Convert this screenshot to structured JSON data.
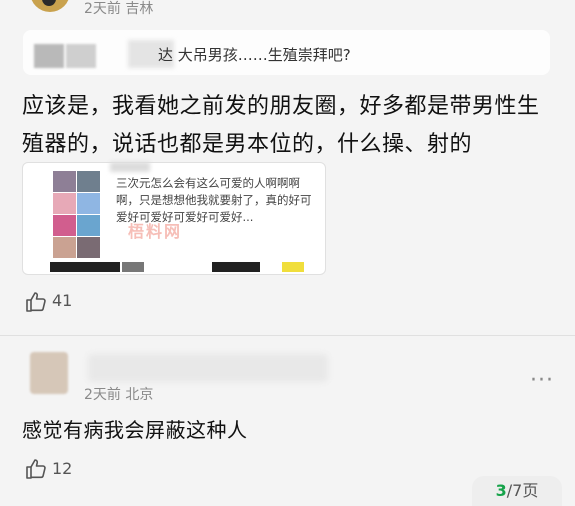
{
  "top_comment": {
    "meta": "2天前 吉林",
    "quote": "达 大吊男孩……生殖崇拜吧?",
    "text": "应该是，我看她之前发的朋友圈，好多都是带男性生殖器的，说话也都是男本位的，什么操、射的",
    "embed": {
      "text": "三次元怎么会有这么可爱的人啊啊啊啊，只是想想他我就要射了，真的好可爱好可爱好可爱好可爱好..."
    },
    "likes": "41"
  },
  "watermark": "梧料网",
  "second_comment": {
    "meta": "2天前 北京",
    "text": "感觉有病我会屏蔽这种人",
    "likes": "12"
  },
  "pagination": {
    "current": "3",
    "total_label": "/7页"
  },
  "icons": {
    "like": "thumbs-up-icon",
    "more": "more-dots-icon"
  },
  "colors": {
    "accent": "#16a34a",
    "watermark": "#f08a7e"
  }
}
